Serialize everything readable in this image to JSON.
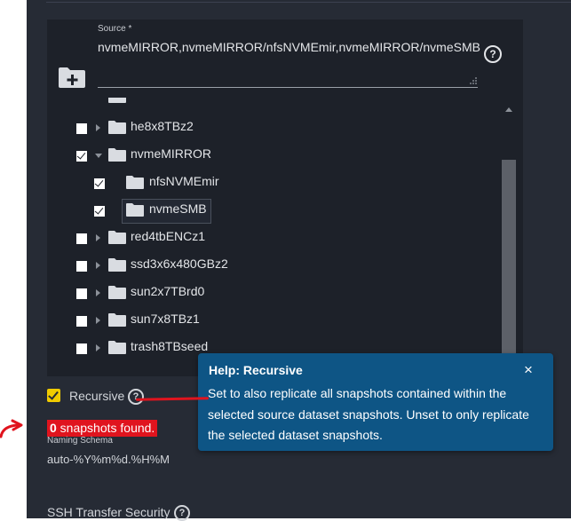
{
  "source": {
    "label": "Source *",
    "value": "nvmeMIRROR,nvmeMIRROR/nfsNVMEmir,nvmeMIRROR/nvmeSMB",
    "help_icon": "help-circle-icon",
    "add_icon": "folder-plus-icon"
  },
  "tree": {
    "nodes": [
      {
        "label": "he8x8TBz2",
        "checked": false,
        "expanded": false,
        "level": 0
      },
      {
        "label": "nvmeMIRROR",
        "checked": true,
        "expanded": true,
        "level": 0
      },
      {
        "label": "nfsNVMEmir",
        "checked": true,
        "level": 1
      },
      {
        "label": "nvmeSMB",
        "checked": true,
        "level": 1,
        "selected": true
      },
      {
        "label": "red4tbENCz1",
        "checked": false,
        "expanded": false,
        "level": 0
      },
      {
        "label": "ssd3x6x480GBz2",
        "checked": false,
        "expanded": false,
        "level": 0
      },
      {
        "label": "sun2x7TBrd0",
        "checked": false,
        "expanded": false,
        "level": 0
      },
      {
        "label": "sun7x8TBz1",
        "checked": false,
        "expanded": false,
        "level": 0
      },
      {
        "label": "trash8TBseed",
        "checked": false,
        "expanded": false,
        "level": 0
      }
    ]
  },
  "recursive": {
    "label": "Recursive",
    "checked": true
  },
  "snapshots": {
    "count": "0",
    "text": " snapshots found."
  },
  "naming_schema": {
    "label": "Naming Schema",
    "value": "auto-%Y%m%d.%H%M"
  },
  "ssh_transfer": {
    "label": "SSH Transfer Security"
  },
  "tooltip": {
    "title": "Help: Recursive",
    "close": "×",
    "body": "Set to also replicate all snapshots contained within the selected source dataset snapshots. Unset to only replicate the selected dataset snapshots."
  },
  "colors": {
    "panel": "#262b35",
    "field": "#1d2129",
    "accent_yellow": "#f0cb00",
    "annotation_red": "#e0141e",
    "tooltip_blue": "#0e5585"
  }
}
